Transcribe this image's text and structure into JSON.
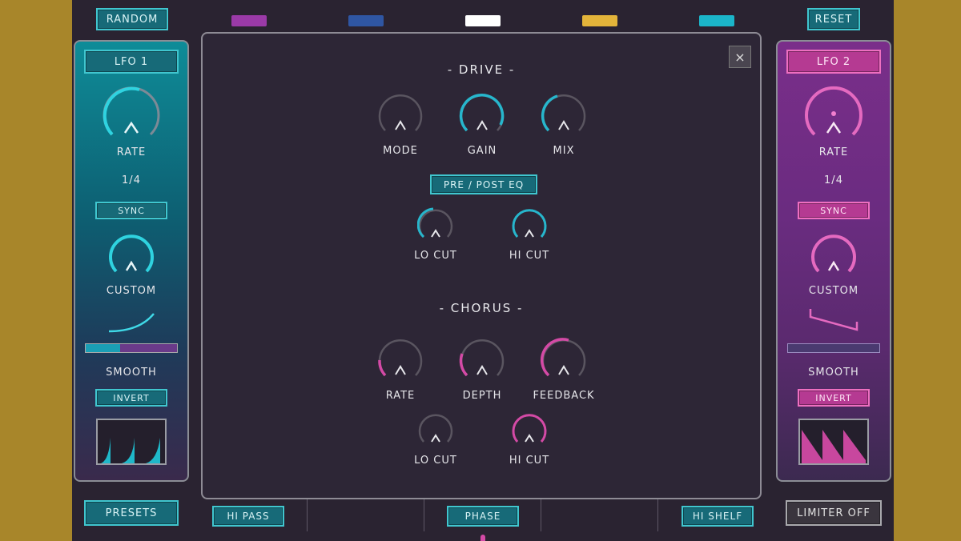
{
  "top": {
    "random_label": "RANDOM",
    "reset_label": "RESET",
    "swatches": [
      "#9b3aa8",
      "#2f56a3",
      "#ffffff",
      "#e3b43a",
      "#1bb5c9"
    ]
  },
  "lfo1": {
    "title": "LFO 1",
    "rate_label": "RATE",
    "rate_value": "1/4",
    "sync_label": "SYNC",
    "custom_label": "CUSTOM",
    "smooth_label": "SMOOTH",
    "invert_label": "INVERT",
    "accent": "#2fc4d2"
  },
  "lfo2": {
    "title": "LFO 2",
    "rate_label": "RATE",
    "rate_value": "1/4",
    "sync_label": "SYNC",
    "custom_label": "CUSTOM",
    "smooth_label": "SMOOTH",
    "invert_label": "INVERT",
    "accent": "#e063b8"
  },
  "modal": {
    "close_label": "×",
    "drive": {
      "title": "- DRIVE -",
      "mode_label": "MODE",
      "gain_label": "GAIN",
      "mix_label": "MIX",
      "prepost_label": "PRE / POST EQ",
      "locut_label": "LO CUT",
      "hicut_label": "HI CUT"
    },
    "chorus": {
      "title": "- CHORUS -",
      "rate_label": "RATE",
      "depth_label": "DEPTH",
      "feedback_label": "FEEDBACK",
      "locut_label": "LO CUT",
      "hicut_label": "HI CUT"
    }
  },
  "bottom": {
    "presets_label": "PRESETS",
    "hipass_label": "HI PASS",
    "phase_label": "PHASE",
    "hishelf_label": "HI SHELF",
    "limiter_label": "LIMITER OFF"
  }
}
